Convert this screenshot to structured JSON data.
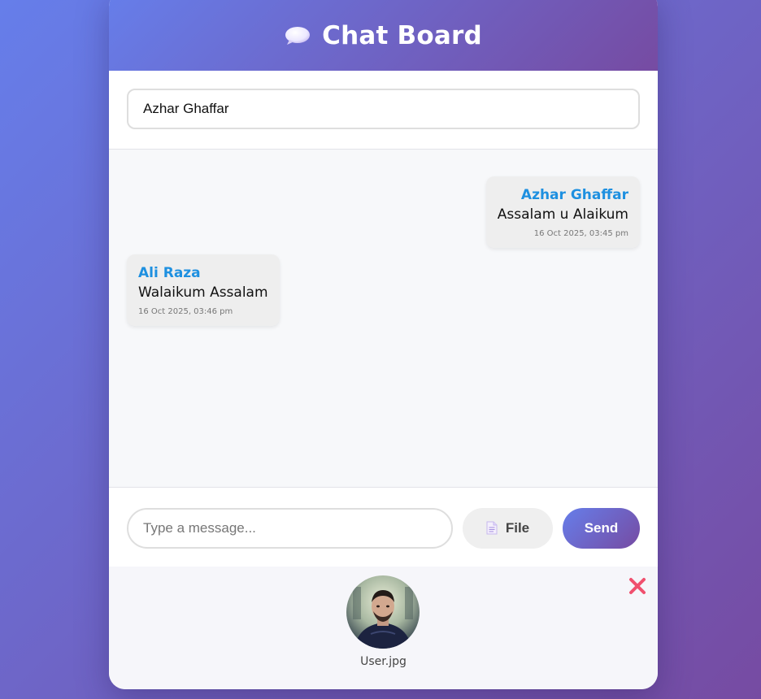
{
  "header": {
    "icon": "speech-bubble-icon",
    "title": "Chat Board"
  },
  "name_field": {
    "value": "Azhar Ghaffar"
  },
  "messages": [
    {
      "sender": "Azhar Ghaffar",
      "text": "Assalam u Alaikum",
      "time": "16 Oct 2025, 03:45 pm",
      "align": "right"
    },
    {
      "sender": "Ali Raza",
      "text": "Walaikum Assalam",
      "time": "16 Oct 2025, 03:46 pm",
      "align": "left"
    }
  ],
  "composer": {
    "placeholder": "Type a message...",
    "file_label": "File",
    "file_icon": "document-icon",
    "send_label": "Send"
  },
  "attachment": {
    "file_name": "User.jpg",
    "remove_icon": "close-icon"
  },
  "colors": {
    "gradient_start": "#667eea",
    "gradient_end": "#764ba2",
    "sender_name": "#1e90e0",
    "remove": "#f0506e"
  }
}
